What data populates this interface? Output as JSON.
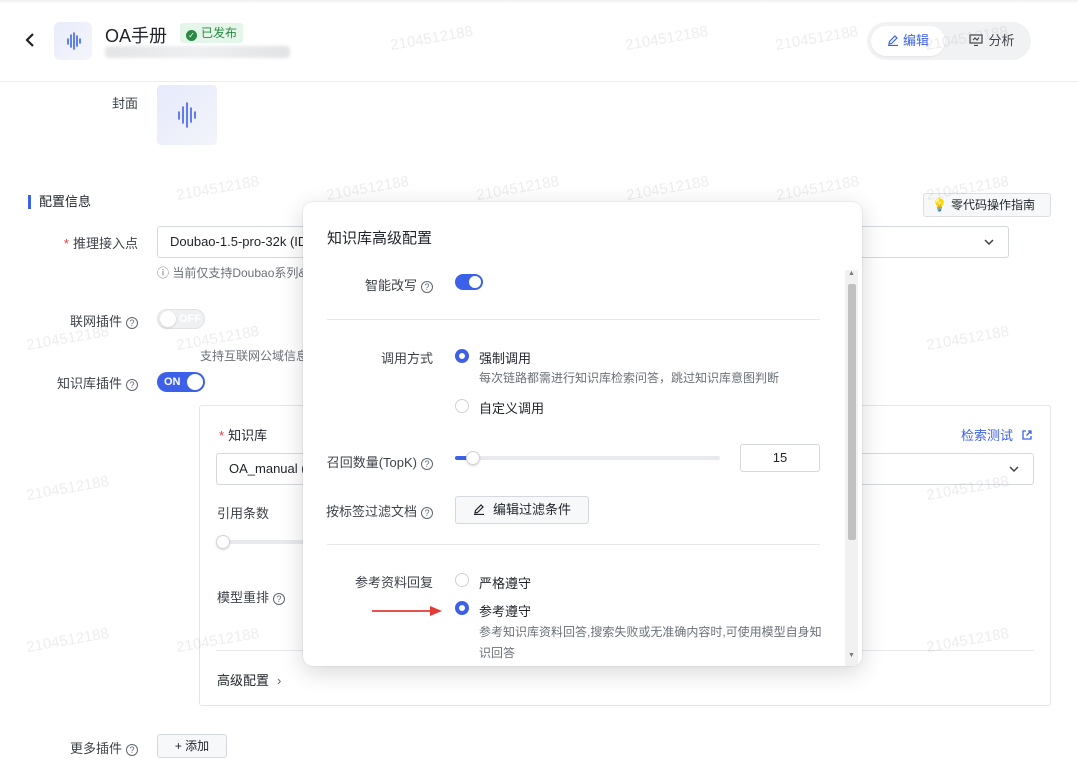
{
  "header": {
    "back_icon": "chevron-left-icon",
    "app_title": "OA手册",
    "status_badge": "已发布",
    "edit_label": "编辑",
    "analysis_label": "分析"
  },
  "cover": {
    "label": "封面"
  },
  "config": {
    "section_title": "配置信息",
    "guide_button": "零代码操作指南",
    "endpoint_label": "推理接入点",
    "endpoint_value": "Doubao-1.5-pro-32k (ID",
    "endpoint_note": "ⓘ 当前仅支持Doubao系列&",
    "web_plugin_label": "联网插件",
    "web_plugin_toggle": "OFF",
    "web_plugin_note": "支持互联网公域信息",
    "kb_plugin_label": "知识库插件",
    "kb_plugin_toggle": "ON",
    "kb_label": "知识库",
    "kb_test_link": "检索测试",
    "kb_value": "OA_manual (",
    "quote_count_label": "引用条数",
    "rerank_label": "模型重排",
    "advanced_label": "高级配置",
    "more_plugins_label": "更多插件",
    "add_button": "+ 添加"
  },
  "modal": {
    "title": "知识库高级配置",
    "smart_rewrite_label": "智能改写",
    "smart_rewrite_on": true,
    "call_mode_label": "调用方式",
    "call_mode_options": [
      {
        "label": "强制调用",
        "checked": true,
        "desc": "每次链路都需进行知识库检索问答，跳过知识库意图判断"
      },
      {
        "label": "自定义调用",
        "checked": false,
        "desc": ""
      }
    ],
    "topk_label": "召回数量(TopK)",
    "topk_value": "15",
    "filter_label": "按标签过滤文档",
    "filter_button": "编辑过滤条件",
    "ref_reply_label": "参考资料回复",
    "ref_reply_options": [
      {
        "label": "严格遵守",
        "checked": false,
        "desc": ""
      },
      {
        "label": "参考遵守",
        "checked": true,
        "desc_line1": "参考知识库资料回答,搜索失败或无准确内容时,可使用模型自身知",
        "desc_line2": "识回答"
      }
    ]
  },
  "watermark": "2104512188",
  "colors": {
    "accent": "#3c61e8",
    "published_bg": "#e3f6e9",
    "published_text": "#2a8a44",
    "required": "#e33b3b",
    "arrow": "#e53935"
  }
}
